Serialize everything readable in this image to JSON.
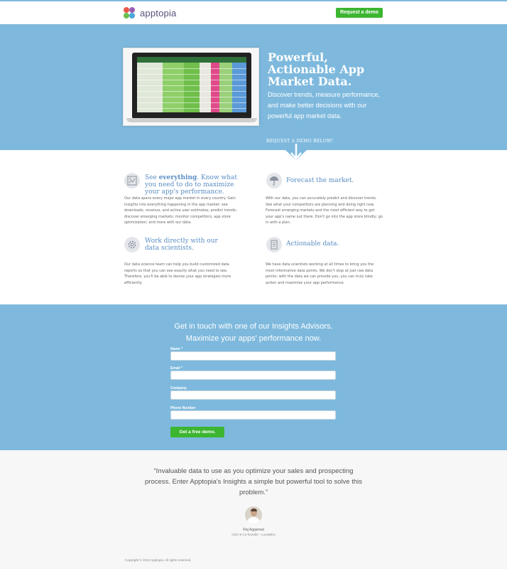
{
  "header": {
    "logo_text": "apptopia",
    "cta_label": "Request a demo",
    "brand_colors": [
      "#e8584a",
      "#9a5fb0",
      "#4aa8d8",
      "#6bbf4e"
    ]
  },
  "hero": {
    "title": "Powerful, Actionable App Market Data.",
    "subtitle": "Discover trends, measure performance, and make better decisions with our powerful app market data.",
    "cta_text": "REQUEST A DEMO BELOW!",
    "image_icon": "laptop-dashboard-screenshot"
  },
  "features": [
    {
      "icon": "chart-dollar-icon",
      "title_pre": "See ",
      "title_bold": "everything",
      "title_post": ". Know what you need to do to maximize your app's performance.",
      "text": "Our data spans every major app market in every country. Gain insights into everything happening in the app market: see downloads, revenue, and active user estimates; predict trends; discover emerging markets; monitor competitors; app store optimization; and more with our data."
    },
    {
      "icon": "umbrella-icon",
      "title": "Forecast the market.",
      "text": "With our data, you can accurately predict and discover trends. See what your competitors are planning and doing right now. Forecast emerging markets and the most efficient way to get your app's name out there. Don't go into the app store blindly; go in with a plan."
    },
    {
      "icon": "gear-icon",
      "title": "Work directly with our data scientists.",
      "text": "Our data science team can help you build customized data reports so that you can see exactly what you need to see. Therefore, you'll be able to devise your app strategies more efficiently."
    },
    {
      "icon": "report-icon",
      "title": "Actionable data.",
      "text": "We have data scientists working at all times to bring you the most informative data points. We don't stop at just raw data points: with the data we can provide you, you can truly take action and maximize your app performance."
    }
  ],
  "contact": {
    "heading1": "Get in touch with one of our Insights Advisors.",
    "heading2": "Maximize your apps' performance now.",
    "fields": [
      {
        "label": "Name *",
        "value": ""
      },
      {
        "label": "Email *",
        "value": ""
      },
      {
        "label": "Company",
        "value": ""
      },
      {
        "label": "Phone Number",
        "value": ""
      }
    ],
    "submit_label": "Get a free demo."
  },
  "testimonial": {
    "quote": "“Invaluable data to use as you optimize your sales and prospecting process. Enter Apptopia's Insights a simple but powerful tool to solve this problem.”",
    "name": "Raj Aggarwal",
    "role": "CEO & Co-founder - Localytics"
  },
  "footer": {
    "copyright": "Copyright © 2013 Apptopia. All rights reserved."
  },
  "colors": {
    "hero_bg": "#7eb9dd",
    "accent_green": "#3cb531",
    "feature_title": "#5b8ec5"
  }
}
